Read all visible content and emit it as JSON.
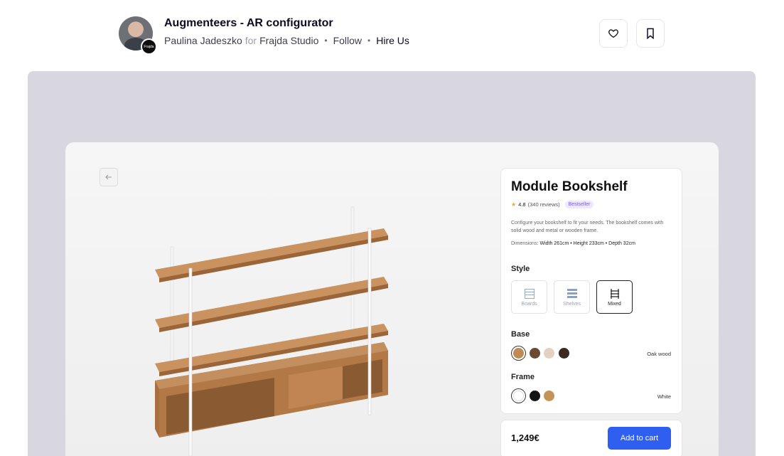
{
  "header": {
    "title": "Augmenteers - AR configurator",
    "author": "Paulina Jadeszko",
    "for_word": "for",
    "team": "Frajda Studio",
    "follow": "Follow",
    "hire": "Hire Us",
    "team_badge": "Frajda",
    "like_icon": "heart-icon",
    "save_icon": "bookmark-icon"
  },
  "product": {
    "title": "Module Bookshelf",
    "rating": "4.8",
    "reviews": "(340 reviews)",
    "badge": "Bestseller",
    "description": "Configure your bookshelf to fit your needs. The bookshelf comes with solid wood and metal or wooden frame.",
    "dimensions_label": "Dimensions:",
    "dimensions_value": "Width 261cm • Height 233cm • Depth 32cm",
    "style": {
      "label": "Style",
      "options": [
        "Boards",
        "Shelves",
        "Mixed"
      ],
      "selected": "Mixed"
    },
    "base": {
      "label": "Base",
      "colors": [
        "#c08a55",
        "#6b4a35",
        "#e3d2c2",
        "#3a2a22"
      ],
      "selected_name": "Oak wood"
    },
    "frame": {
      "label": "Frame",
      "colors": [
        "#ffffff",
        "#151515",
        "#c49358"
      ],
      "selected_name": "White"
    },
    "price": "1,249€",
    "add_to_cart": "Add to cart"
  },
  "colors": {
    "accent": "#2f5ff0",
    "canvas_bg": "#d8d7e0",
    "badge_bg": "#ede8ff",
    "badge_fg": "#7b5cf0",
    "wood": "#b57c4b"
  }
}
